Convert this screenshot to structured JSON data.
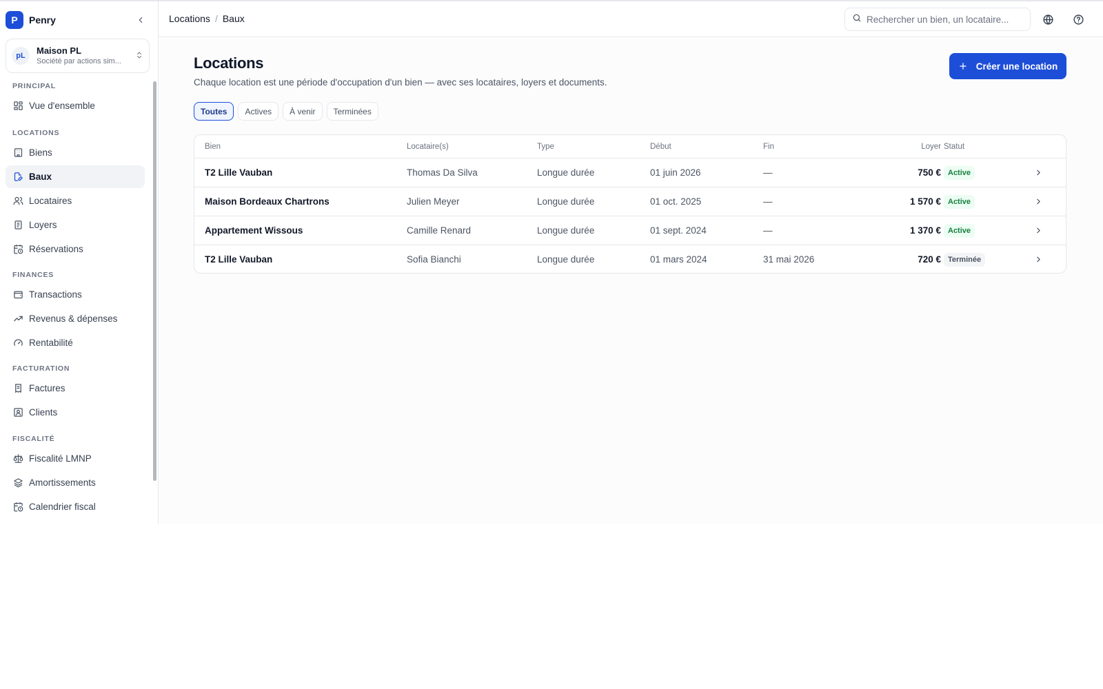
{
  "brand": {
    "logo_letter": "P",
    "name": "Penry"
  },
  "org": {
    "avatar": "pL",
    "name": "Maison PL",
    "subtitle": "Société par actions sim..."
  },
  "sidebar": {
    "sections": [
      {
        "title": "PRINCIPAL"
      },
      {
        "title": "LOCATIONS"
      },
      {
        "title": "FINANCES"
      },
      {
        "title": "FACTURATION"
      },
      {
        "title": "FISCALITÉ"
      }
    ],
    "items": [
      {
        "label": "Vue d'ensemble",
        "icon": "dashboard-icon"
      },
      {
        "label": "Biens",
        "icon": "building-icon"
      },
      {
        "label": "Baux",
        "icon": "lease-document-icon",
        "active": true
      },
      {
        "label": "Locataires",
        "icon": "users-icon"
      },
      {
        "label": "Loyers",
        "icon": "receipt-icon"
      },
      {
        "label": "Réservations",
        "icon": "calendar-clock-icon"
      },
      {
        "label": "Transactions",
        "icon": "wallet-icon"
      },
      {
        "label": "Revenus & dépenses",
        "icon": "trending-up-icon"
      },
      {
        "label": "Rentabilité",
        "icon": "gauge-icon"
      },
      {
        "label": "Factures",
        "icon": "invoice-icon"
      },
      {
        "label": "Clients",
        "icon": "contact-icon"
      },
      {
        "label": "Fiscalité LMNP",
        "icon": "scale-icon"
      },
      {
        "label": "Amortissements",
        "icon": "layers-icon"
      },
      {
        "label": "Calendrier fiscal",
        "icon": "calendar-clock-icon"
      }
    ]
  },
  "topbar": {
    "breadcrumb": [
      "Locations",
      "Baux"
    ],
    "breadcrumb_sep": "/",
    "search_placeholder": "Rechercher un bien, un locataire..."
  },
  "main": {
    "title": "Locations",
    "subtitle": "Chaque location est une période d'occupation d'un bien — avec ses locataires, loyers et documents.",
    "create_label": "Créer une location",
    "filters": [
      {
        "label": "Toutes",
        "active": true
      },
      {
        "label": "Actives"
      },
      {
        "label": "À venir"
      },
      {
        "label": "Terminées"
      }
    ],
    "table": {
      "headers": {
        "bien": "Bien",
        "locataires": "Locataire(s)",
        "type": "Type",
        "debut": "Début",
        "fin": "Fin",
        "loyer": "Loyer",
        "statut": "Statut"
      },
      "rows": [
        {
          "bien": "T2 Lille Vauban",
          "locataires": "Thomas Da Silva",
          "type": "Longue durée",
          "debut": "01 juin 2026",
          "fin": "—",
          "loyer": "750 €",
          "statut": "Active"
        },
        {
          "bien": "Maison Bordeaux Chartrons",
          "locataires": "Julien Meyer",
          "type": "Longue durée",
          "debut": "01 oct. 2025",
          "fin": "—",
          "loyer": "1 570 €",
          "statut": "Active"
        },
        {
          "bien": "Appartement Wissous",
          "locataires": "Camille Renard",
          "type": "Longue durée",
          "debut": "01 sept. 2024",
          "fin": "—",
          "loyer": "1 370 €",
          "statut": "Active"
        },
        {
          "bien": "T2 Lille Vauban",
          "locataires": "Sofia Bianchi",
          "type": "Longue durée",
          "debut": "01 mars 2024",
          "fin": "31 mai 2026",
          "loyer": "720 €",
          "statut": "Terminée"
        }
      ]
    }
  },
  "colors": {
    "accent": "#1d4ed8",
    "active_badge": "#15803d",
    "border": "#e5e7eb"
  }
}
